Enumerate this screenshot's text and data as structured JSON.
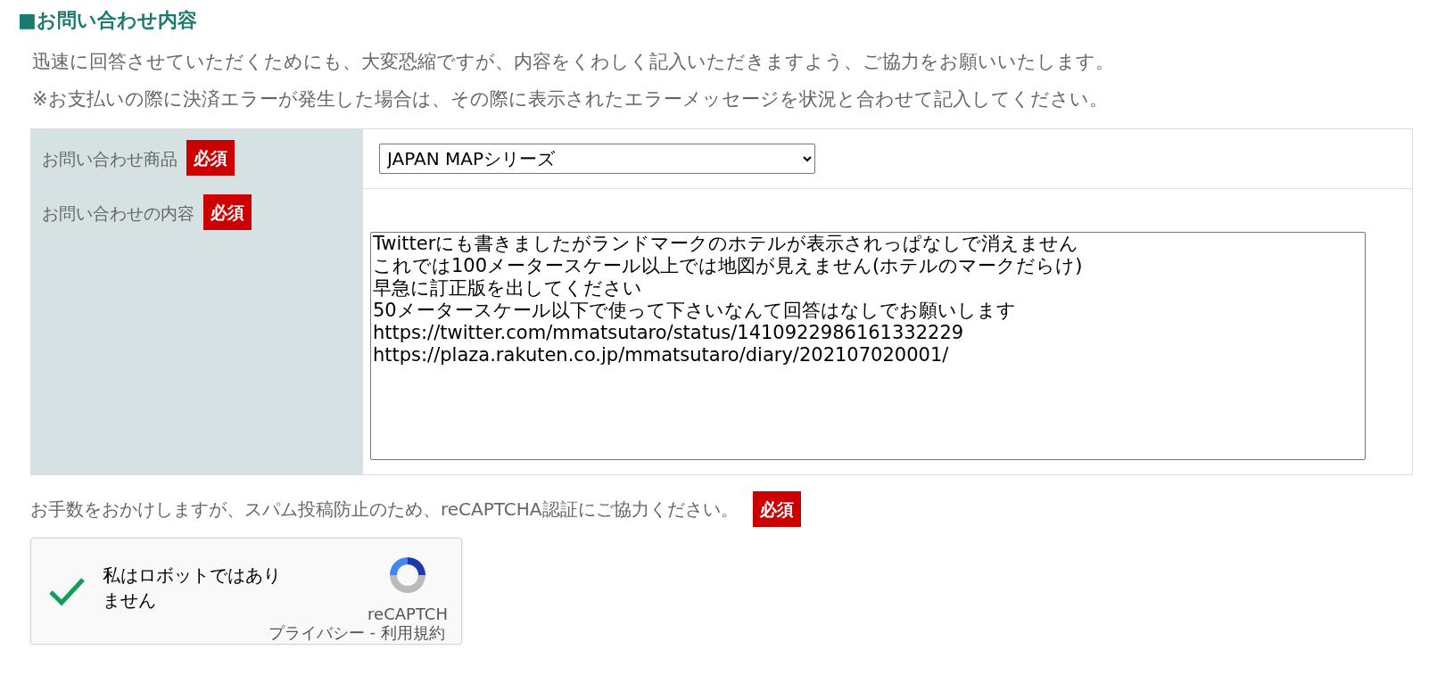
{
  "section_title": "■お問い合わせ内容",
  "intro": [
    "迅速に回答させていただくためにも、大変恐縮ですが、内容をくわしく記入いただきますよう、ご協力をお願いいたします。",
    "※お支払いの際に決済エラーが発生した場合は、その際に表示されたエラーメッセージを状況と合わせて記入してください。"
  ],
  "form_rows": [
    {
      "kind": "select",
      "label": "お問い合わせ商品",
      "required_badge": "必須",
      "value": "JAPAN MAPシリーズ"
    },
    {
      "kind": "textarea",
      "label": "お問い合わせの内容",
      "required_badge": "必須",
      "lines": [
        "Twitterにも書きましたがランドマークのホテルが表示されっぱなしで消えません",
        "これでは100メータースケール以上では地図が見えません(ホテルのマークだらけ)",
        "早急に訂正版を出してください",
        "50メータースケール以下で使って下さいなんて回答はなしでお願いします",
        "https://twitter.com/mmatsutaro/status/1410922986161332229",
        "https://plaza.rakuten.co.jp/mmatsutaro/diary/202107020001/"
      ]
    }
  ],
  "captcha_note": {
    "text": "お手数をおかけしますが、スパム投稿防止のため、reCAPTCHA認証にご協力ください。",
    "required_badge": "必須"
  },
  "captcha": {
    "checked": true,
    "label": "私はロボットではありません",
    "brand": "reCAPTCH",
    "privacy_link": "プライバシー",
    "separator": "-",
    "terms_link": "利用規約"
  }
}
